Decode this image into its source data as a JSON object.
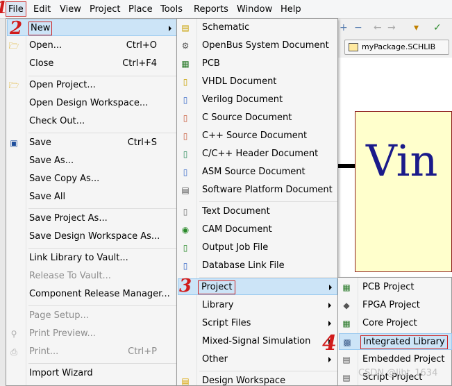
{
  "menubar": {
    "items": [
      "File",
      "Edit",
      "View",
      "Project",
      "Place",
      "Tools",
      "Reports",
      "Window",
      "Help"
    ],
    "step_number": "1"
  },
  "editor": {
    "tab_label": "myPackage.SCHLIB",
    "canvas_text": "Vin",
    "toolbar_glyphs": [
      "+",
      "−",
      "←",
      "→",
      "▾",
      "✓"
    ]
  },
  "file_menu": {
    "items": [
      {
        "label": "New",
        "shortcut": "",
        "submenu": true,
        "step": "2"
      },
      {
        "label": "Open...",
        "shortcut": "Ctrl+O"
      },
      {
        "label": "Close",
        "shortcut": "Ctrl+F4"
      },
      {
        "label": "Open Project..."
      },
      {
        "label": "Open Design Workspace..."
      },
      {
        "label": "Check Out..."
      },
      {
        "label": "Save",
        "shortcut": "Ctrl+S"
      },
      {
        "label": "Save As..."
      },
      {
        "label": "Save Copy As..."
      },
      {
        "label": "Save All"
      },
      {
        "label": "Save Project As..."
      },
      {
        "label": "Save Design Workspace As..."
      },
      {
        "label": "Link Library to Vault..."
      },
      {
        "label": "Release To Vault..."
      },
      {
        "label": "Component Release Manager..."
      },
      {
        "label": "Page Setup..."
      },
      {
        "label": "Print Preview..."
      },
      {
        "label": "Print...",
        "shortcut": "Ctrl+P"
      },
      {
        "label": "Import Wizard"
      }
    ]
  },
  "new_menu": {
    "items": [
      "Schematic",
      "OpenBus System Document",
      "PCB",
      "VHDL Document",
      "Verilog Document",
      "C Source Document",
      "C++ Source Document",
      "C/C++ Header Document",
      "ASM Source Document",
      "Software Platform Document",
      "Text Document",
      "CAM Document",
      "Output Job File",
      "Database Link File",
      "Project",
      "Library",
      "Script Files",
      "Mixed-Signal Simulation",
      "Other",
      "Design Workspace"
    ],
    "step_number": "3"
  },
  "project_menu": {
    "items": [
      "PCB Project",
      "FPGA Project",
      "Core Project",
      "Integrated Library",
      "Embedded Project",
      "Script Project"
    ],
    "step_number": "4"
  },
  "watermark": "CSDN @libt_1634",
  "colors": {
    "highlight": "#cce4f7",
    "annotation_red": "#d11b1b",
    "canvas_text": "#1a1a8a"
  }
}
